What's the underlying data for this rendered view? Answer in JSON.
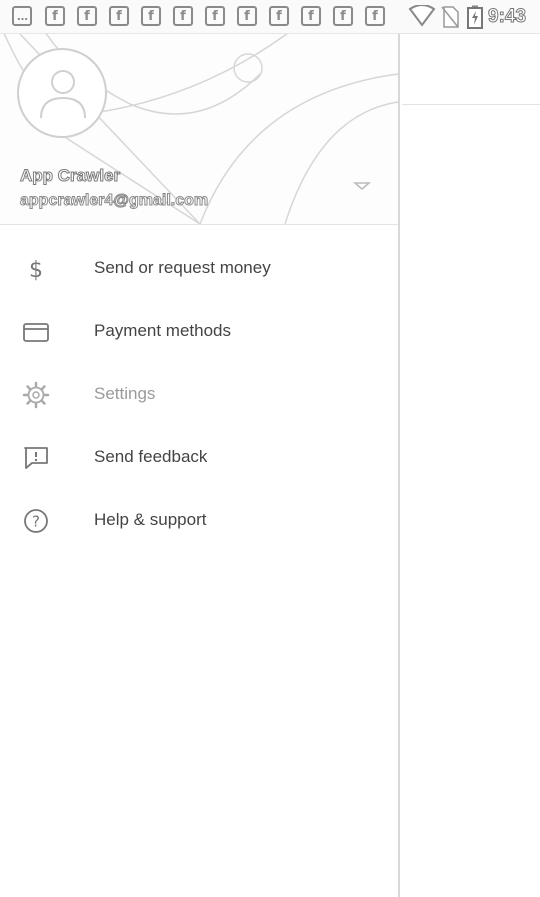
{
  "status_bar": {
    "notifications": [
      "…",
      "f",
      "f",
      "f",
      "f",
      "f",
      "f",
      "f",
      "f",
      "f",
      "f",
      "f"
    ],
    "time": "9:43",
    "icons": [
      "wifi-icon",
      "no-sim-icon",
      "battery-charging-icon"
    ]
  },
  "drawer": {
    "account": {
      "name": "App Crawler",
      "email": "appcrawler4@gmail.com"
    },
    "menu": [
      {
        "label": "Send or request money",
        "icon": "dollar-icon"
      },
      {
        "label": "Payment methods",
        "icon": "card-icon"
      },
      {
        "label": "Settings",
        "icon": "gear-icon"
      },
      {
        "label": "Send feedback",
        "icon": "feedback-icon"
      },
      {
        "label": "Help & support",
        "icon": "help-icon"
      }
    ]
  },
  "colors": {
    "background": "#ffffff",
    "text": "#444444",
    "icon": "#8a8a8a",
    "divider": "#e3e3e3"
  }
}
